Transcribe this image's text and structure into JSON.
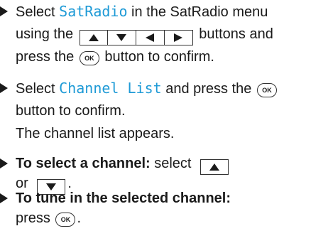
{
  "steps": [
    {
      "line1_a": "Select ",
      "line1_kw": "SatRadio",
      "line1_b": " in the SatRadio menu",
      "line2_a": "using the",
      "line2_b": "buttons and",
      "line3_a": "press the",
      "line3_b": "button to confirm."
    },
    {
      "line1_a": "Select ",
      "line1_kw": "Channel List",
      "line1_b": " and press the",
      "line2": "button to confirm.",
      "line3": "The channel list appears."
    },
    {
      "bold": "To select a channel:",
      "line1_b": " select",
      "line2_a": "or",
      "line2_b": "."
    },
    {
      "bold": "To tune in the selected channel:",
      "line2_a": "press",
      "line2_b": "."
    }
  ],
  "ok_label": "OK",
  "icons": {
    "bullet": "right-triangle-bullet",
    "up": "up-arrow-icon",
    "down": "down-arrow-icon",
    "left": "left-arrow-icon",
    "right": "right-arrow-icon",
    "ok": "ok-button-icon"
  }
}
